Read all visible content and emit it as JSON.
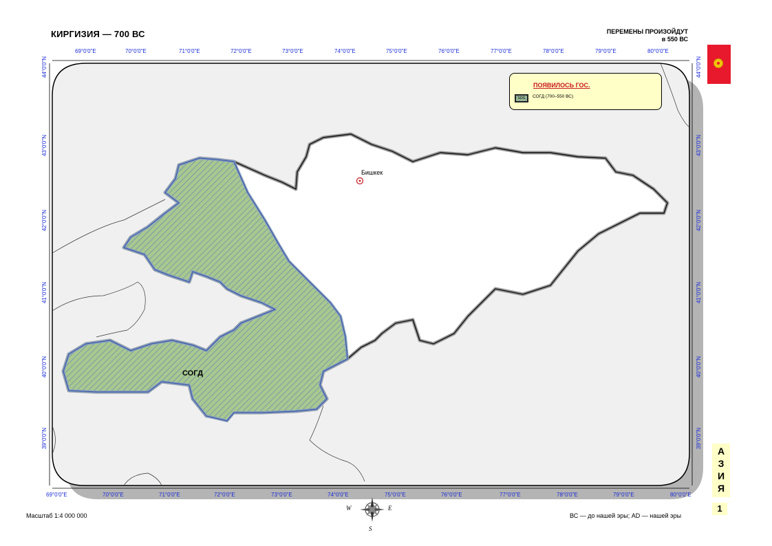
{
  "title": "КИРГИЗИЯ — 700 ВС",
  "changes": {
    "line1": "ПЕРЕМЕНЫ ПРОИЗОЙДУТ",
    "line2": "в 550 ВС"
  },
  "flag": {
    "icon": "sun-emblem-icon",
    "background": "#e8192c"
  },
  "continent_tab": {
    "letters": [
      "А",
      "З",
      "И",
      "Я"
    ],
    "page_number": "1"
  },
  "scale": "Масштаб 1:4 000 000",
  "era_note": "ВС — до нашей эры; AD — нашей эры",
  "compass": {
    "icon": "compass-rose-icon",
    "w": "W",
    "e": "E",
    "s": "S"
  },
  "legend": {
    "title": "ПОЯВИЛОСЬ ГОС.",
    "swatch_text": "SOG",
    "item": "СОГД (700–550 ВС)"
  },
  "city": {
    "name": "Бишкек",
    "icon": "capital-city-icon"
  },
  "region": {
    "name": "СОГД",
    "fill": "#a8c890",
    "hatch": "#5b7fb0"
  },
  "colors": {
    "land": "#f0f0f0",
    "kyrgyzstan": "#ffffff",
    "shadow": "#b4b4b4",
    "legend_bg": "#ffffc8",
    "graticule_text": "#1a2bd6"
  },
  "graticule": {
    "top_lon": [
      "69°0'0\"E",
      "70°0'0\"E",
      "71°0'0\"E",
      "72°0'0\"E",
      "73°0'0\"E",
      "74°0'0\"E",
      "75°0'0\"E",
      "76°0'0\"E",
      "77°0'0\"E",
      "78°0'0\"E",
      "79°0'0\"E",
      "80°0'0\"E"
    ],
    "bottom_lon": [
      "69°0'0\"E",
      "70°0'0\"E",
      "71°0'0\"E",
      "72°0'0\"E",
      "73°0'0\"E",
      "74°0'0\"E",
      "75°0'0\"E",
      "76°0'0\"E",
      "77°0'0\"E",
      "78°0'0\"E",
      "79°0'0\"E",
      "80°0'0\"E"
    ],
    "lat": [
      "44°0'0\"N",
      "43°0'0\"N",
      "42°0'0\"N",
      "41°0'0\"N",
      "40°0'0\"N",
      "39°0'0\"N"
    ]
  }
}
